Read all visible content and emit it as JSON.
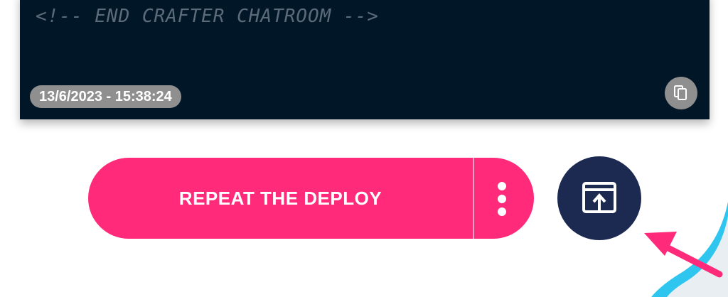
{
  "code_panel": {
    "comment_text": "<!-- END CRAFTER CHATROOM -->",
    "timestamp": "13/6/2023 - 15:38:24",
    "copy_icon": "copy-icon",
    "background": "#011627"
  },
  "actions": {
    "deploy_label": "REPEAT THE DEPLOY",
    "more_icon": "more-vertical-icon",
    "open_icon": "open-in-window-icon",
    "deploy_color": "#ff2a7a",
    "open_color": "#1c2a52"
  },
  "annotation": {
    "arrow_color": "#ff2a7a",
    "arc_color": "#2ec6ef"
  }
}
